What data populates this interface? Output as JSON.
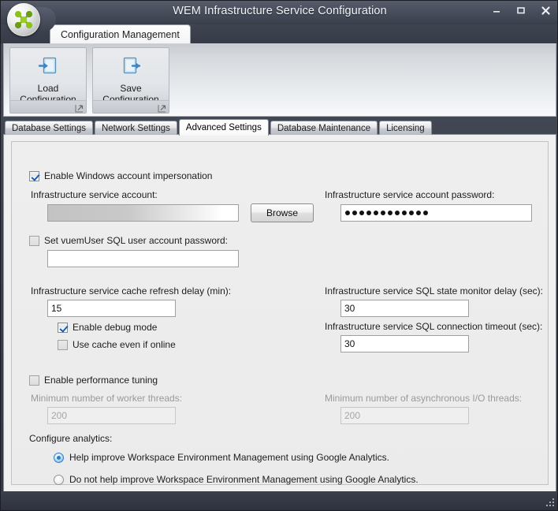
{
  "window": {
    "title": "WEM Infrastructure Service Configuration",
    "logo_icon": "wem-molecule-logo-icon",
    "minimize_label": "–",
    "maximize_label": "▭",
    "close_label": "X"
  },
  "ribbon": {
    "tab_label": "Configuration Management",
    "groups": [
      {
        "label": "Load Configuration",
        "icon": "load-configuration-icon"
      },
      {
        "label": "Save Configuration",
        "icon": "save-configuration-icon"
      }
    ]
  },
  "tabs": [
    {
      "label": "Database Settings",
      "active": false
    },
    {
      "label": "Network Settings",
      "active": false
    },
    {
      "label": "Advanced Settings",
      "active": true
    },
    {
      "label": "Database Maintenance",
      "active": false
    },
    {
      "label": "Licensing",
      "active": false
    }
  ],
  "advanced": {
    "impersonation": {
      "checkbox_label": "Enable Windows account impersonation",
      "checked": true
    },
    "service_account": {
      "label": "Infrastructure service account:",
      "value": "",
      "redacted": true
    },
    "browse_button": "Browse",
    "service_account_password": {
      "label": "Infrastructure service account password:",
      "masked_value": "••••••••••••",
      "dot_count": 12
    },
    "vuem_user": {
      "checkbox_label": "Set vuemUser SQL user account password:",
      "checked": false,
      "value": ""
    },
    "cache_refresh": {
      "label": "Infrastructure service cache refresh delay (min):",
      "value": "15"
    },
    "debug_mode": {
      "checkbox_label": "Enable debug mode",
      "checked": true
    },
    "use_cache_offline": {
      "checkbox_label": "Use cache even if online",
      "checked": false
    },
    "sql_state_monitor": {
      "label": "Infrastructure service SQL state monitor delay (sec):",
      "value": "30"
    },
    "sql_connection_timeout": {
      "label": "Infrastructure service SQL connection timeout (sec):",
      "value": "30"
    },
    "performance_tuning": {
      "checkbox_label": "Enable performance tuning",
      "checked": false
    },
    "worker_threads": {
      "label": "Minimum number of worker threads:",
      "value": "200",
      "disabled": true
    },
    "async_io_threads": {
      "label": "Minimum number of asynchronous I/O threads:",
      "value": "200",
      "disabled": true
    },
    "analytics": {
      "label": "Configure analytics:",
      "options": [
        {
          "label": "Help improve Workspace Environment Management using Google Analytics.",
          "selected": true
        },
        {
          "label": "Do not help improve Workspace Environment Management using Google Analytics.",
          "selected": false
        }
      ]
    }
  },
  "statusbar": {
    "resize_grip_icon": "resize-grip-icon"
  },
  "colors": {
    "accent": "#2a7ec0",
    "titlebar": "#474d5b",
    "panel": "#ebebeb"
  }
}
